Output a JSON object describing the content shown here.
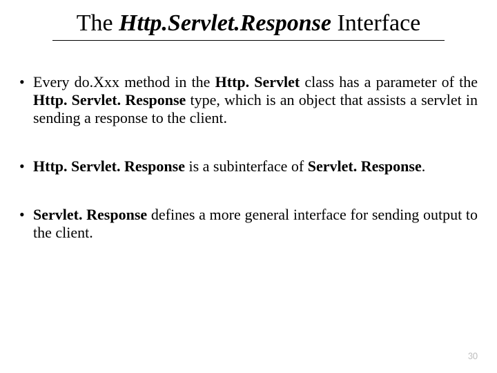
{
  "title": {
    "pre": "The ",
    "emph": "Http.Servlet.Response",
    "post": " Interface"
  },
  "bullets": [
    {
      "parts": [
        {
          "t": "Every do.Xxx method in the "
        },
        {
          "t": "Http. Servlet",
          "bold": true
        },
        {
          "t": " class has a parameter of the "
        },
        {
          "t": "Http. Servlet. Response",
          "bold": true
        },
        {
          "t": " type, which is an object that assists a servlet in sending a response to the client."
        }
      ]
    },
    {
      "parts": [
        {
          "t": "Http. Servlet. Response",
          "bold": true
        },
        {
          "t": " is a subinterface of "
        },
        {
          "t": "Servlet. Response",
          "bold": true
        },
        {
          "t": "."
        }
      ]
    },
    {
      "parts": [
        {
          "t": "Servlet. Response",
          "bold": true
        },
        {
          "t": " defines a more general interface for sending output to the client."
        }
      ]
    }
  ],
  "page_number": "30"
}
